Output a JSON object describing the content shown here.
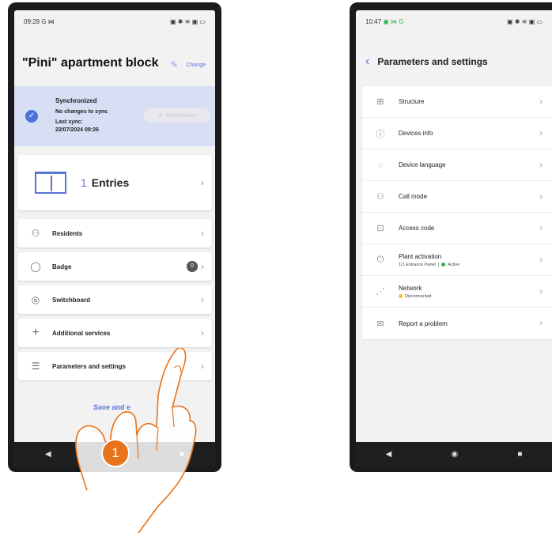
{
  "left_phone": {
    "status": {
      "time": "09:28",
      "left_icons": "G ⋈",
      "right_icons": "▣ ✱ ≋ ▣ ▭"
    },
    "title": "\"Pini\" apartment block",
    "change_label": "Change",
    "sync": {
      "heading": "Synchronized",
      "line1": "No changes to sync",
      "line2": "Last sync:",
      "line3": "22/07/2024 09:26",
      "button_label": "Synchronize"
    },
    "entries": {
      "count": "1",
      "label": "Entries"
    },
    "menu": [
      {
        "label": "Residents",
        "icon": "residents-icon"
      },
      {
        "label": "Badge",
        "icon": "badge-icon",
        "count": "0"
      },
      {
        "label": "Switchboard",
        "icon": "switchboard-icon"
      },
      {
        "label": "Additional services",
        "icon": "plus-icon"
      },
      {
        "label": "Parameters and settings",
        "icon": "sliders-icon"
      }
    ],
    "save_label": "Save and e",
    "step_number": "1"
  },
  "right_phone": {
    "status": {
      "time": "10:47",
      "left_icons": "▣ ⋈ G",
      "right_icons": "▣ ✱ ≋ ▣ ▭"
    },
    "header_title": "Parameters and settings",
    "menu": [
      {
        "label": "Structure",
        "icon": "structure-icon"
      },
      {
        "label": "Devices info",
        "icon": "info-icon"
      },
      {
        "label": "Device language",
        "icon": "language-icon"
      },
      {
        "label": "Call mode",
        "icon": "call-mode-icon"
      },
      {
        "label": "Access code",
        "icon": "lock-icon"
      },
      {
        "label": "Plant activation",
        "icon": "power-icon",
        "sub_left": "1/1 Entrance Panel",
        "sub_sep": "|",
        "sub_right": "Active",
        "status_color": "#2db34a"
      },
      {
        "label": "Network",
        "icon": "network-icon",
        "sub_right": "Disconnected",
        "status_color": "#f2c230"
      },
      {
        "label": "Report a problem",
        "icon": "mail-icon"
      }
    ]
  },
  "colors": {
    "accent": "#5a74d6",
    "sync_bg": "#d8dff5",
    "step_badge": "#e8731a"
  }
}
